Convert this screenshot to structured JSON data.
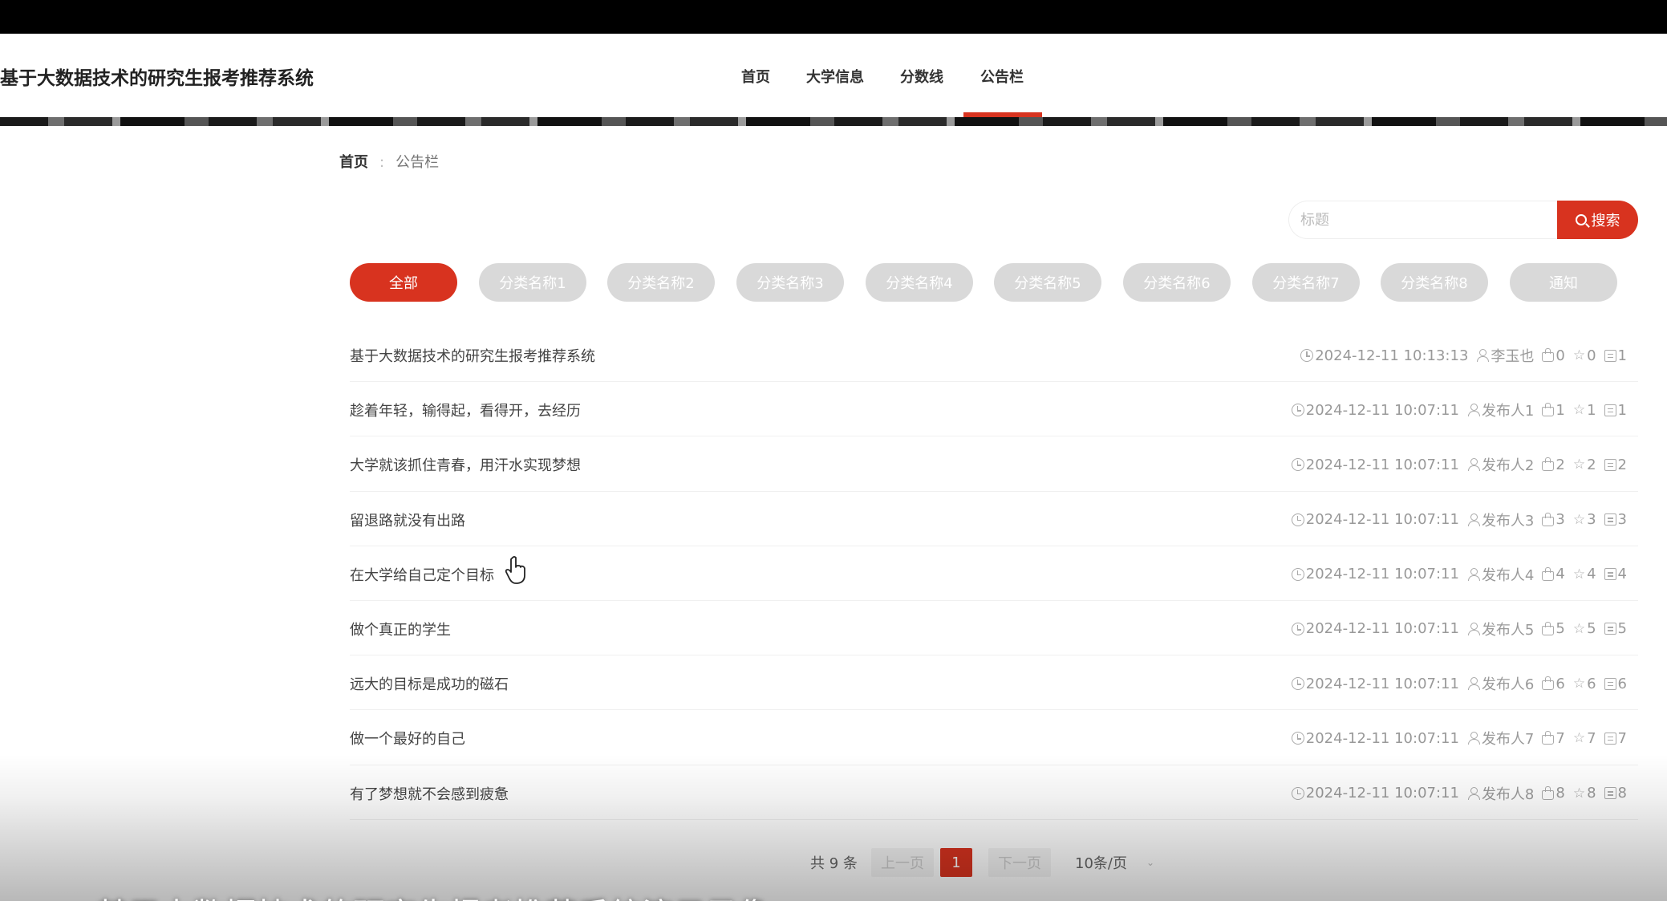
{
  "site": {
    "title": "基于大数据技术的研究生报考推荐系统"
  },
  "nav": {
    "items": [
      {
        "label": "首页"
      },
      {
        "label": "大学信息"
      },
      {
        "label": "分数线"
      },
      {
        "label": "公告栏"
      }
    ],
    "active_index": 3
  },
  "breadcrumb": {
    "home": "首页",
    "separator": ":",
    "current": "公告栏"
  },
  "search": {
    "placeholder": "标题",
    "button_label": "搜索"
  },
  "categories": [
    {
      "label": "全部",
      "active": true
    },
    {
      "label": "分类名称1"
    },
    {
      "label": "分类名称2"
    },
    {
      "label": "分类名称3"
    },
    {
      "label": "分类名称4"
    },
    {
      "label": "分类名称5"
    },
    {
      "label": "分类名称6"
    },
    {
      "label": "分类名称7"
    },
    {
      "label": "分类名称8"
    },
    {
      "label": "通知"
    }
  ],
  "notices": [
    {
      "title": "基于大数据技术的研究生报考推荐系统",
      "time": "2024-12-11 10:13:13",
      "author": "李玉也",
      "likes": "0",
      "favorites": "0",
      "comments": "1"
    },
    {
      "title": "趁着年轻，输得起，看得开，去经历",
      "time": "2024-12-11 10:07:11",
      "author": "发布人1",
      "likes": "1",
      "favorites": "1",
      "comments": "1"
    },
    {
      "title": "大学就该抓住青春，用汗水实现梦想",
      "time": "2024-12-11 10:07:11",
      "author": "发布人2",
      "likes": "2",
      "favorites": "2",
      "comments": "2"
    },
    {
      "title": "留退路就没有出路",
      "time": "2024-12-11 10:07:11",
      "author": "发布人3",
      "likes": "3",
      "favorites": "3",
      "comments": "3"
    },
    {
      "title": "在大学给自己定个目标",
      "time": "2024-12-11 10:07:11",
      "author": "发布人4",
      "likes": "4",
      "favorites": "4",
      "comments": "4"
    },
    {
      "title": "做个真正的学生",
      "time": "2024-12-11 10:07:11",
      "author": "发布人5",
      "likes": "5",
      "favorites": "5",
      "comments": "5"
    },
    {
      "title": "远大的目标是成功的磁石",
      "time": "2024-12-11 10:07:11",
      "author": "发布人6",
      "likes": "6",
      "favorites": "6",
      "comments": "6"
    },
    {
      "title": "做一个最好的自己",
      "time": "2024-12-11 10:07:11",
      "author": "发布人7",
      "likes": "7",
      "favorites": "7",
      "comments": "7"
    },
    {
      "title": "有了梦想就不会感到疲惫",
      "time": "2024-12-11 10:07:11",
      "author": "发布人8",
      "likes": "8",
      "favorites": "8",
      "comments": "8"
    }
  ],
  "pagination": {
    "total_label": "共 9 条",
    "prev_label": "上一页",
    "current_page": "1",
    "next_label": "下一页",
    "page_size_label": "10条/页"
  },
  "caption": {
    "text": "基于大数据技术的研究生报考推荐系统演示录像"
  },
  "colors": {
    "accent": "#d8331f",
    "pill_inactive": "#d9d9d9"
  }
}
